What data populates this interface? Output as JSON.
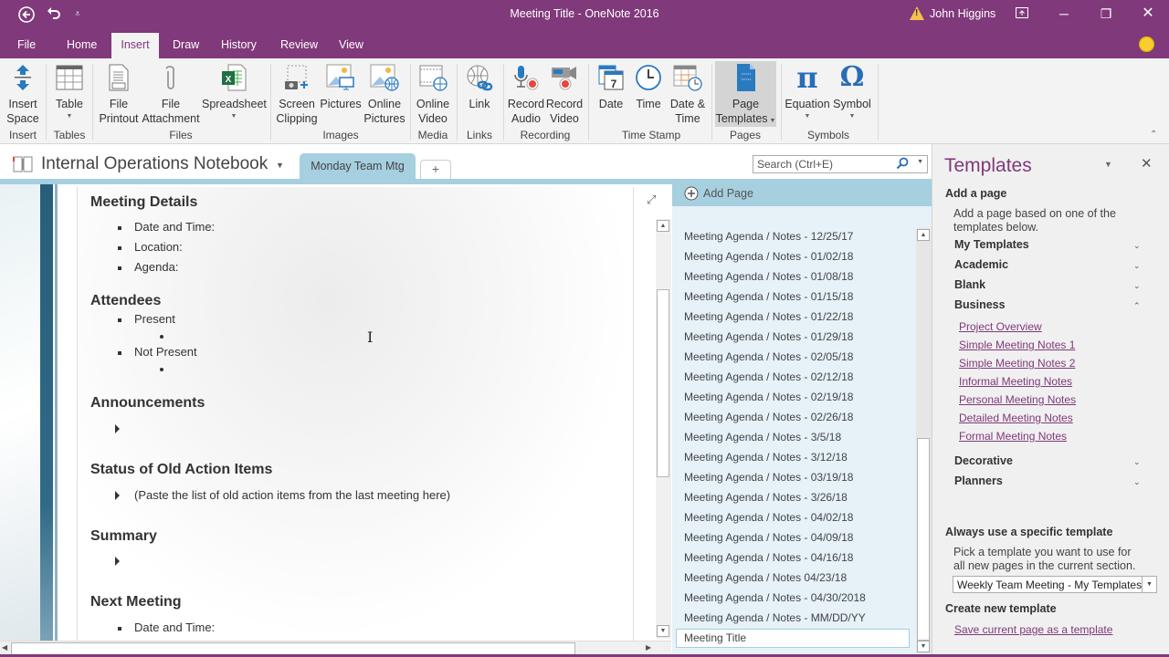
{
  "window": {
    "title": "Meeting Title  -  OneNote 2016",
    "user": "John Higgins",
    "accent": "#80397b"
  },
  "quick_access": {
    "back_icon": "back-arrow-icon",
    "undo_icon": "undo-icon",
    "customize_icon": "customize-qat-icon"
  },
  "ribbon_tabs": [
    "File",
    "Home",
    "Insert",
    "Draw",
    "History",
    "Review",
    "View"
  ],
  "active_tab": "Insert",
  "ribbon": {
    "groups": [
      {
        "name": "Insert",
        "buttons": [
          {
            "label1": "Insert",
            "label2": "Space"
          }
        ]
      },
      {
        "name": "Tables",
        "buttons": [
          {
            "label1": "Table",
            "label2": ""
          }
        ]
      },
      {
        "name": "Files",
        "buttons": [
          {
            "label1": "File",
            "label2": "Printout"
          },
          {
            "label1": "File",
            "label2": "Attachment"
          },
          {
            "label1": "Spreadsheet",
            "label2": ""
          }
        ]
      },
      {
        "name": "Images",
        "buttons": [
          {
            "label1": "Screen",
            "label2": "Clipping"
          },
          {
            "label1": "Pictures",
            "label2": ""
          },
          {
            "label1": "Online",
            "label2": "Pictures"
          }
        ]
      },
      {
        "name": "Media",
        "buttons": [
          {
            "label1": "Online",
            "label2": "Video"
          }
        ]
      },
      {
        "name": "Links",
        "buttons": [
          {
            "label1": "Link",
            "label2": ""
          }
        ]
      },
      {
        "name": "Recording",
        "buttons": [
          {
            "label1": "Record",
            "label2": "Audio"
          },
          {
            "label1": "Record",
            "label2": "Video"
          }
        ]
      },
      {
        "name": "Time Stamp",
        "buttons": [
          {
            "label1": "Date",
            "label2": ""
          },
          {
            "label1": "Time",
            "label2": ""
          },
          {
            "label1": "Date &",
            "label2": "Time"
          }
        ]
      },
      {
        "name": "Pages",
        "buttons": [
          {
            "label1": "Page",
            "label2": "Templates"
          }
        ]
      },
      {
        "name": "Symbols",
        "buttons": [
          {
            "label1": "Equation",
            "label2": ""
          },
          {
            "label1": "Symbol",
            "label2": ""
          }
        ]
      }
    ]
  },
  "notebook": {
    "name": "Internal Operations Notebook",
    "section": "Monday Team Mtg",
    "add_section": "+",
    "search_placeholder": "Search (Ctrl+E)"
  },
  "page": {
    "sections": [
      {
        "heading": "Meeting Details",
        "items": [
          "Date and Time:",
          "Location:",
          "Agenda:"
        ]
      },
      {
        "heading": "Attendees",
        "items": [
          "Present",
          "Not Present"
        ]
      },
      {
        "heading": "Announcements",
        "items": [
          ""
        ]
      },
      {
        "heading": "Status of Old Action Items",
        "items": [
          "(Paste the list of old action items from the last meeting here)"
        ]
      },
      {
        "heading": "Summary",
        "items": [
          ""
        ]
      },
      {
        "heading": "Next Meeting",
        "items": [
          "Date and Time:"
        ]
      }
    ]
  },
  "page_list": {
    "add_page": "Add Page",
    "pages": [
      "Meeting Agenda / Notes - 12/25/17",
      "Meeting Agenda / Notes - 01/02/18",
      "Meeting Agenda / Notes - 01/08/18",
      "Meeting Agenda / Notes - 01/15/18",
      "Meeting Agenda / Notes - 01/22/18",
      "Meeting Agenda / Notes - 01/29/18",
      "Meeting Agenda / Notes - 02/05/18",
      "Meeting Agenda / Notes - 02/12/18",
      "Meeting Agenda / Notes - 02/19/18",
      "Meeting Agenda / Notes - 02/26/18",
      "Meeting Agenda / Notes - 3/5/18",
      "Meeting Agenda / Notes - 3/12/18",
      "Meeting Agenda / Notes - 03/19/18",
      "Meeting Agenda / Notes - 3/26/18",
      "Meeting Agenda / Notes - 04/02/18",
      "Meeting Agenda / Notes - 04/09/18",
      "Meeting Agenda / Notes - 04/16/18",
      "Meeting Agenda / Notes 04/23/18",
      "Meeting Agenda / Notes - 04/30/2018",
      "Meeting Agenda / Notes - MM/DD/YY",
      "Meeting Title"
    ],
    "selected": "Meeting Title"
  },
  "templates_pane": {
    "title": "Templates",
    "add_a_page": "Add a page",
    "add_desc": "Add a page based on one of the templates below.",
    "categories": [
      {
        "name": "My Templates",
        "expanded": false
      },
      {
        "name": "Academic",
        "expanded": false
      },
      {
        "name": "Blank",
        "expanded": false
      },
      {
        "name": "Business",
        "expanded": true,
        "items": [
          "Project Overview",
          "Simple Meeting Notes 1",
          "Simple Meeting Notes 2",
          "Informal Meeting Notes",
          "Personal Meeting Notes",
          "Detailed Meeting Notes",
          "Formal Meeting Notes"
        ]
      },
      {
        "name": "Decorative",
        "expanded": false
      },
      {
        "name": "Planners",
        "expanded": false
      }
    ],
    "always_use_heading": "Always use a specific template",
    "always_use_desc": "Pick a template you want to use for all new pages in the current section.",
    "selected_template": "Weekly Team Meeting - My Templates",
    "create_heading": "Create new template",
    "save_link": "Save current page as a template"
  }
}
